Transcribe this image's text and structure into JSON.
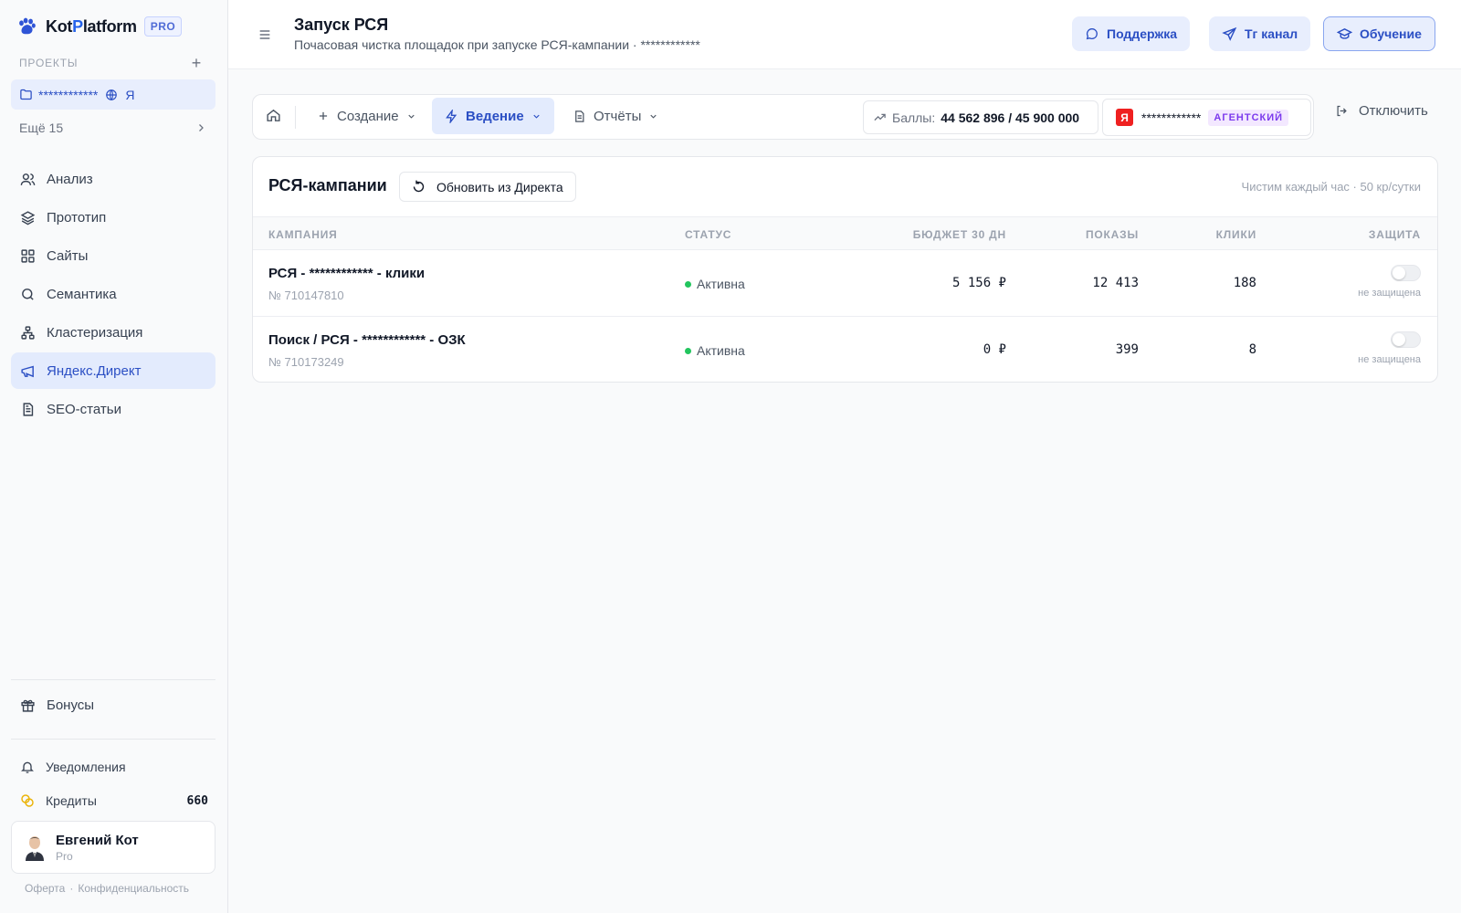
{
  "brand": {
    "name_prefix": "Kot",
    "name_p": "P",
    "name_suffix": "latform",
    "badge": "PRO"
  },
  "sidebar": {
    "projects_heading": "ПРОЕКТЫ",
    "add_icon": "plus-icon",
    "current_project": {
      "name": "************",
      "marker": "Я"
    },
    "more_label": "Ещё 15",
    "items": [
      {
        "label": "Анализ",
        "icon": "users-icon"
      },
      {
        "label": "Прототип",
        "icon": "layers-icon"
      },
      {
        "label": "Сайты",
        "icon": "grid-icon"
      },
      {
        "label": "Семантика",
        "icon": "search-icon"
      },
      {
        "label": "Кластеризация",
        "icon": "network-icon"
      },
      {
        "label": "Яндекс.Директ",
        "icon": "megaphone-icon",
        "active": true
      },
      {
        "label": "SEO-статьи",
        "icon": "document-icon"
      }
    ],
    "bonus_label": "Бонусы",
    "notifications_label": "Уведомления",
    "credits_label": "Кредиты",
    "credits_count": "660",
    "user": {
      "name": "Евгений Кот",
      "plan": "Pro"
    },
    "footer": {
      "offer": "Оферта",
      "privacy": "Конфиденциальность"
    }
  },
  "header": {
    "title": "Запуск РСЯ",
    "subtitle": "Почасовая чистка площадок при запуске РСЯ-кампании · ************",
    "support_label": "Поддержка",
    "tg_label": "Тг канал",
    "edu_label": "Обучение"
  },
  "toolbar": {
    "create_label": "Создание",
    "manage_label": "Ведение",
    "reports_label": "Отчёты",
    "balance_label": "Баллы:",
    "balance_value": "44 562 896 / 45 900 000",
    "account_mark": "Я",
    "account_name": "************",
    "account_badge": "АГЕНТСКИЙ",
    "disconnect_label": "Отключить"
  },
  "campaigns": {
    "title": "РСЯ-кампании",
    "refresh_label": "Обновить из Директа",
    "note": "Чистим каждый час · 50 кр/сутки",
    "columns": [
      "КАМПАНИЯ",
      "СТАТУС",
      "БЮДЖЕТ 30 ДН",
      "ПОКАЗЫ",
      "КЛИКИ",
      "ЗАЩИТА"
    ],
    "rows": [
      {
        "name": "РСЯ - ************ - клики",
        "id": "№ 710147810",
        "status": "Активна",
        "budget": "5 156 ₽",
        "impressions": "12 413",
        "clicks": "188",
        "protection": "не защищена",
        "protected": false
      },
      {
        "name": "Поиск / РСЯ - ************ - ОЗК",
        "id": "№ 710173249",
        "status": "Активна",
        "budget": "0 ₽",
        "impressions": "399",
        "clicks": "8",
        "protection": "не защищена",
        "protected": false
      }
    ]
  },
  "colors": {
    "accent": "#2b4fc4",
    "accent_bg": "#e8eefd",
    "status_active": "#22c55e",
    "agency_badge": "#7c3aed"
  }
}
